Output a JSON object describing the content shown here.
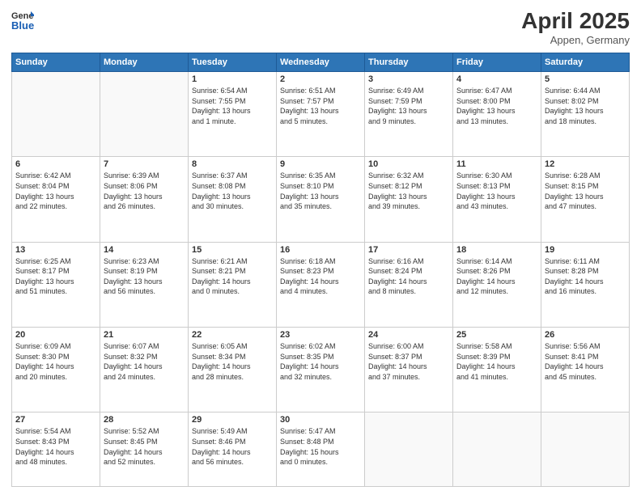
{
  "header": {
    "logo_line1": "General",
    "logo_line2": "Blue",
    "title": "April 2025",
    "subtitle": "Appen, Germany"
  },
  "days_of_week": [
    "Sunday",
    "Monday",
    "Tuesday",
    "Wednesday",
    "Thursday",
    "Friday",
    "Saturday"
  ],
  "weeks": [
    [
      {
        "day": "",
        "info": ""
      },
      {
        "day": "",
        "info": ""
      },
      {
        "day": "1",
        "info": "Sunrise: 6:54 AM\nSunset: 7:55 PM\nDaylight: 13 hours\nand 1 minute."
      },
      {
        "day": "2",
        "info": "Sunrise: 6:51 AM\nSunset: 7:57 PM\nDaylight: 13 hours\nand 5 minutes."
      },
      {
        "day": "3",
        "info": "Sunrise: 6:49 AM\nSunset: 7:59 PM\nDaylight: 13 hours\nand 9 minutes."
      },
      {
        "day": "4",
        "info": "Sunrise: 6:47 AM\nSunset: 8:00 PM\nDaylight: 13 hours\nand 13 minutes."
      },
      {
        "day": "5",
        "info": "Sunrise: 6:44 AM\nSunset: 8:02 PM\nDaylight: 13 hours\nand 18 minutes."
      }
    ],
    [
      {
        "day": "6",
        "info": "Sunrise: 6:42 AM\nSunset: 8:04 PM\nDaylight: 13 hours\nand 22 minutes."
      },
      {
        "day": "7",
        "info": "Sunrise: 6:39 AM\nSunset: 8:06 PM\nDaylight: 13 hours\nand 26 minutes."
      },
      {
        "day": "8",
        "info": "Sunrise: 6:37 AM\nSunset: 8:08 PM\nDaylight: 13 hours\nand 30 minutes."
      },
      {
        "day": "9",
        "info": "Sunrise: 6:35 AM\nSunset: 8:10 PM\nDaylight: 13 hours\nand 35 minutes."
      },
      {
        "day": "10",
        "info": "Sunrise: 6:32 AM\nSunset: 8:12 PM\nDaylight: 13 hours\nand 39 minutes."
      },
      {
        "day": "11",
        "info": "Sunrise: 6:30 AM\nSunset: 8:13 PM\nDaylight: 13 hours\nand 43 minutes."
      },
      {
        "day": "12",
        "info": "Sunrise: 6:28 AM\nSunset: 8:15 PM\nDaylight: 13 hours\nand 47 minutes."
      }
    ],
    [
      {
        "day": "13",
        "info": "Sunrise: 6:25 AM\nSunset: 8:17 PM\nDaylight: 13 hours\nand 51 minutes."
      },
      {
        "day": "14",
        "info": "Sunrise: 6:23 AM\nSunset: 8:19 PM\nDaylight: 13 hours\nand 56 minutes."
      },
      {
        "day": "15",
        "info": "Sunrise: 6:21 AM\nSunset: 8:21 PM\nDaylight: 14 hours\nand 0 minutes."
      },
      {
        "day": "16",
        "info": "Sunrise: 6:18 AM\nSunset: 8:23 PM\nDaylight: 14 hours\nand 4 minutes."
      },
      {
        "day": "17",
        "info": "Sunrise: 6:16 AM\nSunset: 8:24 PM\nDaylight: 14 hours\nand 8 minutes."
      },
      {
        "day": "18",
        "info": "Sunrise: 6:14 AM\nSunset: 8:26 PM\nDaylight: 14 hours\nand 12 minutes."
      },
      {
        "day": "19",
        "info": "Sunrise: 6:11 AM\nSunset: 8:28 PM\nDaylight: 14 hours\nand 16 minutes."
      }
    ],
    [
      {
        "day": "20",
        "info": "Sunrise: 6:09 AM\nSunset: 8:30 PM\nDaylight: 14 hours\nand 20 minutes."
      },
      {
        "day": "21",
        "info": "Sunrise: 6:07 AM\nSunset: 8:32 PM\nDaylight: 14 hours\nand 24 minutes."
      },
      {
        "day": "22",
        "info": "Sunrise: 6:05 AM\nSunset: 8:34 PM\nDaylight: 14 hours\nand 28 minutes."
      },
      {
        "day": "23",
        "info": "Sunrise: 6:02 AM\nSunset: 8:35 PM\nDaylight: 14 hours\nand 32 minutes."
      },
      {
        "day": "24",
        "info": "Sunrise: 6:00 AM\nSunset: 8:37 PM\nDaylight: 14 hours\nand 37 minutes."
      },
      {
        "day": "25",
        "info": "Sunrise: 5:58 AM\nSunset: 8:39 PM\nDaylight: 14 hours\nand 41 minutes."
      },
      {
        "day": "26",
        "info": "Sunrise: 5:56 AM\nSunset: 8:41 PM\nDaylight: 14 hours\nand 45 minutes."
      }
    ],
    [
      {
        "day": "27",
        "info": "Sunrise: 5:54 AM\nSunset: 8:43 PM\nDaylight: 14 hours\nand 48 minutes."
      },
      {
        "day": "28",
        "info": "Sunrise: 5:52 AM\nSunset: 8:45 PM\nDaylight: 14 hours\nand 52 minutes."
      },
      {
        "day": "29",
        "info": "Sunrise: 5:49 AM\nSunset: 8:46 PM\nDaylight: 14 hours\nand 56 minutes."
      },
      {
        "day": "30",
        "info": "Sunrise: 5:47 AM\nSunset: 8:48 PM\nDaylight: 15 hours\nand 0 minutes."
      },
      {
        "day": "",
        "info": ""
      },
      {
        "day": "",
        "info": ""
      },
      {
        "day": "",
        "info": ""
      }
    ]
  ]
}
